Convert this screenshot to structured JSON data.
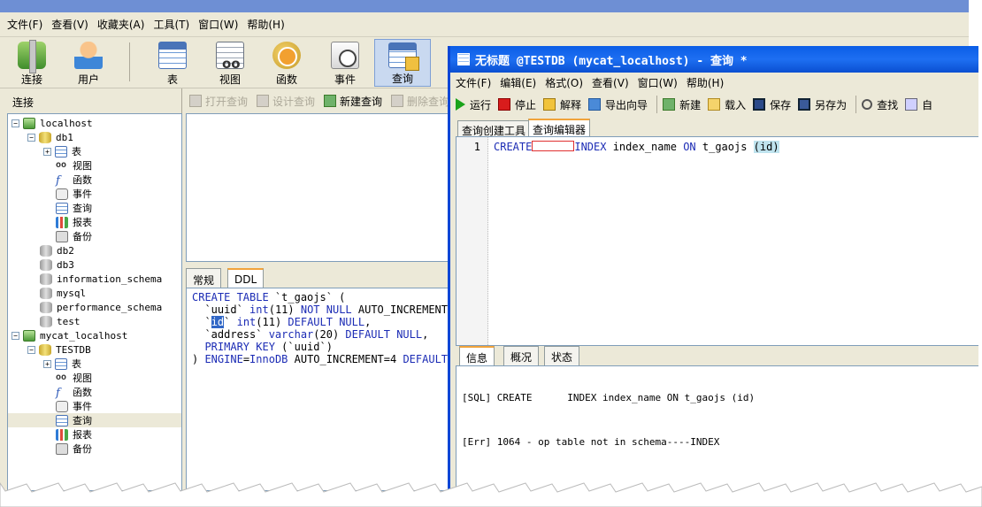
{
  "main": {
    "menu": [
      "文件(F)",
      "查看(V)",
      "收藏夹(A)",
      "工具(T)",
      "窗口(W)",
      "帮助(H)"
    ],
    "toolbar": {
      "connect": "连接",
      "user": "用户",
      "table": "表",
      "view": "视图",
      "function": "函数",
      "event": "事件",
      "query": "查询"
    },
    "left_header": "连接",
    "mid_toolbar": {
      "open_query": "打开查询",
      "design_query": "设计查询",
      "new_query": "新建查询",
      "delete_query": "删除查询"
    },
    "tabs": [
      "常规",
      "DDL"
    ],
    "ddl": {
      "l1a": "CREATE TABLE",
      "l1b": " `t_gaojs` (",
      "l2a": "  `uuid` ",
      "l2b": "int",
      "l2c": "(11) ",
      "l2d": "NOT NULL",
      "l2e": " AUTO_INCREMENT,",
      "l3a": "  `",
      "l3b": "id",
      "l3c": "` ",
      "l3d": "int",
      "l3e": "(11) ",
      "l3f": "DEFAULT NULL",
      "l3g": ",",
      "l4a": "  `address` ",
      "l4b": "varchar",
      "l4c": "(20) ",
      "l4d": "DEFAULT NULL",
      "l4e": ",",
      "l5a": "  PRIMARY KEY",
      "l5b": " (`uuid`)",
      "l6a": ") ",
      "l6b": "ENGINE",
      "l6c": "=",
      "l6d": "InnoDB",
      "l6e": " AUTO_INCREMENT=4 ",
      "l6f": "DEFAULT"
    }
  },
  "tree": {
    "localhost": "localhost",
    "db1": "db1",
    "db1_items": [
      "表",
      "视图",
      "函数",
      "事件",
      "查询",
      "报表",
      "备份"
    ],
    "db2": "db2",
    "db3": "db3",
    "information_schema": "information_schema",
    "mysql": "mysql",
    "performance_schema": "performance_schema",
    "test": "test",
    "mycat_localhost": "mycat_localhost",
    "testdb": "TESTDB",
    "testdb_items": [
      "表",
      "视图",
      "函数",
      "事件",
      "查询",
      "报表",
      "备份"
    ]
  },
  "query_window": {
    "title": "无标题 @TESTDB (mycat_localhost) - 查询 *",
    "menu": [
      "文件(F)",
      "编辑(E)",
      "格式(O)",
      "查看(V)",
      "窗口(W)",
      "帮助(H)"
    ],
    "toolbar": {
      "run": "运行",
      "stop": "停止",
      "explain": "解释",
      "export": "导出向导",
      "new": "新建",
      "load": "载入",
      "save": "保存",
      "saveas": "另存为",
      "find": "查找",
      "more": "自"
    },
    "tabs": [
      "查询创建工具",
      "查询编辑器"
    ],
    "line_number": "1",
    "code": {
      "create": "CREATE",
      "index": "INDEX",
      "name": " index_name ",
      "on": "ON",
      "table": " t_gaojs ",
      "paren": "(id)"
    },
    "info_tabs": [
      "信息",
      "概况",
      "状态"
    ],
    "info": {
      "sql": "[SQL] CREATE      INDEX index_name ON t_gaojs (id)",
      "err": "[Err] 1064 - op table not in schema----INDEX"
    }
  }
}
